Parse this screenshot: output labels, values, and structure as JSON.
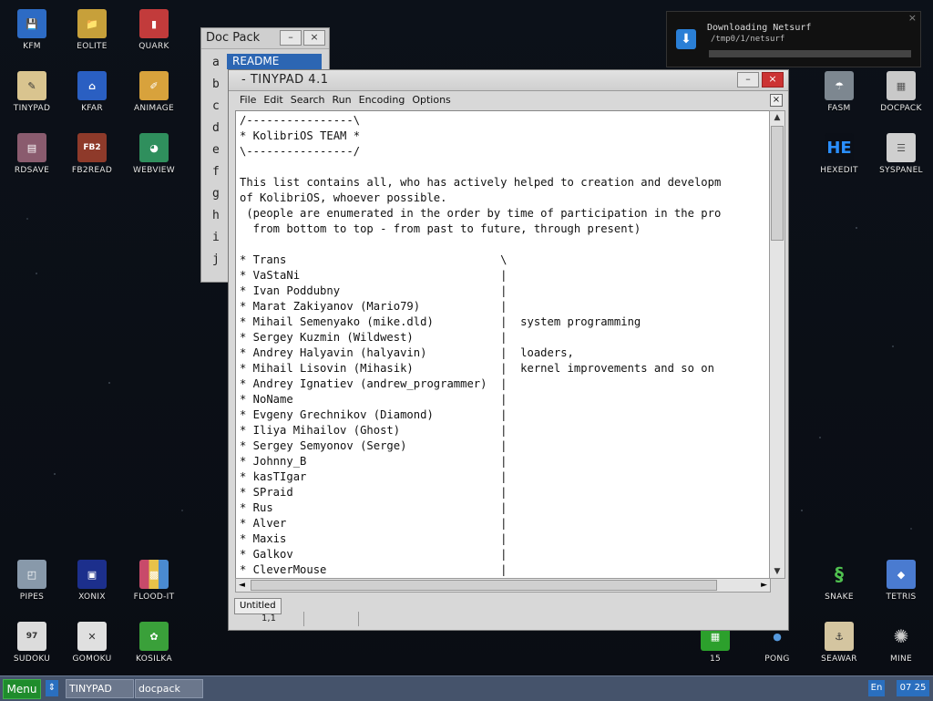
{
  "desktop": {
    "icons": [
      {
        "label": "KFM",
        "glyph": "💾",
        "color": "#2d6bc4"
      },
      {
        "label": "EOLITE",
        "glyph": "📁",
        "color": "#c7a03a"
      },
      {
        "label": "QUARK",
        "glyph": "▮",
        "color": "#c23b3b"
      },
      {
        "label": "TINYPAD",
        "glyph": "✎",
        "color": "#d9c48f"
      },
      {
        "label": "KFAR",
        "glyph": "⌂",
        "color": "#2a5fc2"
      },
      {
        "label": "ANIMAGE",
        "glyph": "✐",
        "color": "#d8a23c"
      },
      {
        "label": "RDSAVE",
        "glyph": "▤",
        "color": "#8a5b6e"
      },
      {
        "label": "FB2READ",
        "glyph": "FB2",
        "color": "#8e3a2a"
      },
      {
        "label": "WEBVIEW",
        "glyph": "◕",
        "color": "#2f8f5d"
      },
      {
        "label": "FASM",
        "glyph": "☂",
        "color": "#7d8790"
      },
      {
        "label": "DOCPACK",
        "glyph": "▦",
        "color": "#c9c9c9"
      },
      {
        "label": "HEXEDIT",
        "glyph": "HE",
        "color": "#2a6fd6"
      },
      {
        "label": "SYSPANEL",
        "glyph": "☰",
        "color": "#cfcfcf"
      },
      {
        "label": "PIPES",
        "glyph": "◰",
        "color": "#8899aa"
      },
      {
        "label": "XONIX",
        "glyph": "▣",
        "color": "#1c2f8c"
      },
      {
        "label": "FLOOD-IT",
        "glyph": "▩",
        "color": "#c84a6a"
      },
      {
        "label": "SNAKE",
        "glyph": "§",
        "color": "#3c9a3c"
      },
      {
        "label": "TETRIS",
        "glyph": "◆",
        "color": "#4a7bd0"
      },
      {
        "label": "SUDOKU",
        "glyph": "97",
        "color": "#dcdcdc"
      },
      {
        "label": "GOMOKU",
        "glyph": "✕",
        "color": "#e0e0e0"
      },
      {
        "label": "KOSILKA",
        "glyph": "✿",
        "color": "#3aa03a"
      },
      {
        "label": "15",
        "glyph": "▦",
        "color": "#2ca02c"
      },
      {
        "label": "PONG",
        "glyph": "●",
        "color": "#5599dd"
      },
      {
        "label": "SEAWAR",
        "glyph": "⚓",
        "color": "#d4c5a0"
      },
      {
        "label": "MINE",
        "glyph": "✺",
        "color": "#555"
      }
    ]
  },
  "notification": {
    "title": "Downloading Netsurf",
    "path": "/tmp0/1/netsurf",
    "close": "×",
    "progress": 0.0
  },
  "docpack": {
    "title": "Doc Pack",
    "minimize": "–",
    "close": "×",
    "selected": "README",
    "letters": [
      "a",
      "b",
      "c",
      "d",
      "e",
      "f",
      "g",
      "h",
      "i",
      "j"
    ]
  },
  "tinypad": {
    "title": "- TINYPAD 4.1",
    "minimize": "–",
    "close": "×",
    "menu": [
      "File",
      "Edit",
      "Search",
      "Run",
      "Encoding",
      "Options"
    ],
    "menu_close": "×",
    "content": "/----------------\\\n* KolibriOS TEAM *\n\\----------------/\n\nThis list contains all, who has actively helped to creation and developm\nof KolibriOS, whoever possible.\n (people are enumerated in the order by time of participation in the pro\n  from bottom to top - from past to future, through present)\n\n* Trans                                \\\n* VaStaNi                              |\n* Ivan Poddubny                        |\n* Marat Zakiyanov (Mario79)            |\n* Mihail Semenyako (mike.dld)          |  system programming\n* Sergey Kuzmin (Wildwest)             |\n* Andrey Halyavin (halyavin)           |  loaders,\n* Mihail Lisovin (Mihasik)             |  kernel improvements and so on\n* Andrey Ignatiev (andrew_programmer)  |\n* NoName                               |\n* Evgeny Grechnikov (Diamond)          |\n* Iliya Mihailov (Ghost)               |\n* Sergey Semyonov (Serge)              |\n* Johnny_B                             |\n* kasTIgar                             |\n* SPraid                               |\n* Rus                                  |\n* Alver                                |\n* Maxis                                |\n* Galkov                               |\n* CleverMouse                          |",
    "scroll_up": "▲",
    "scroll_down": "▼",
    "scroll_left": "◄",
    "scroll_right": "►",
    "tab": "Untitled",
    "status_pos": "1,1"
  },
  "taskbar": {
    "menu": "Menu",
    "switch": "⇕",
    "tasks": [
      "TINYPAD",
      "docpack"
    ],
    "lang": "En",
    "clock": "07 25"
  }
}
